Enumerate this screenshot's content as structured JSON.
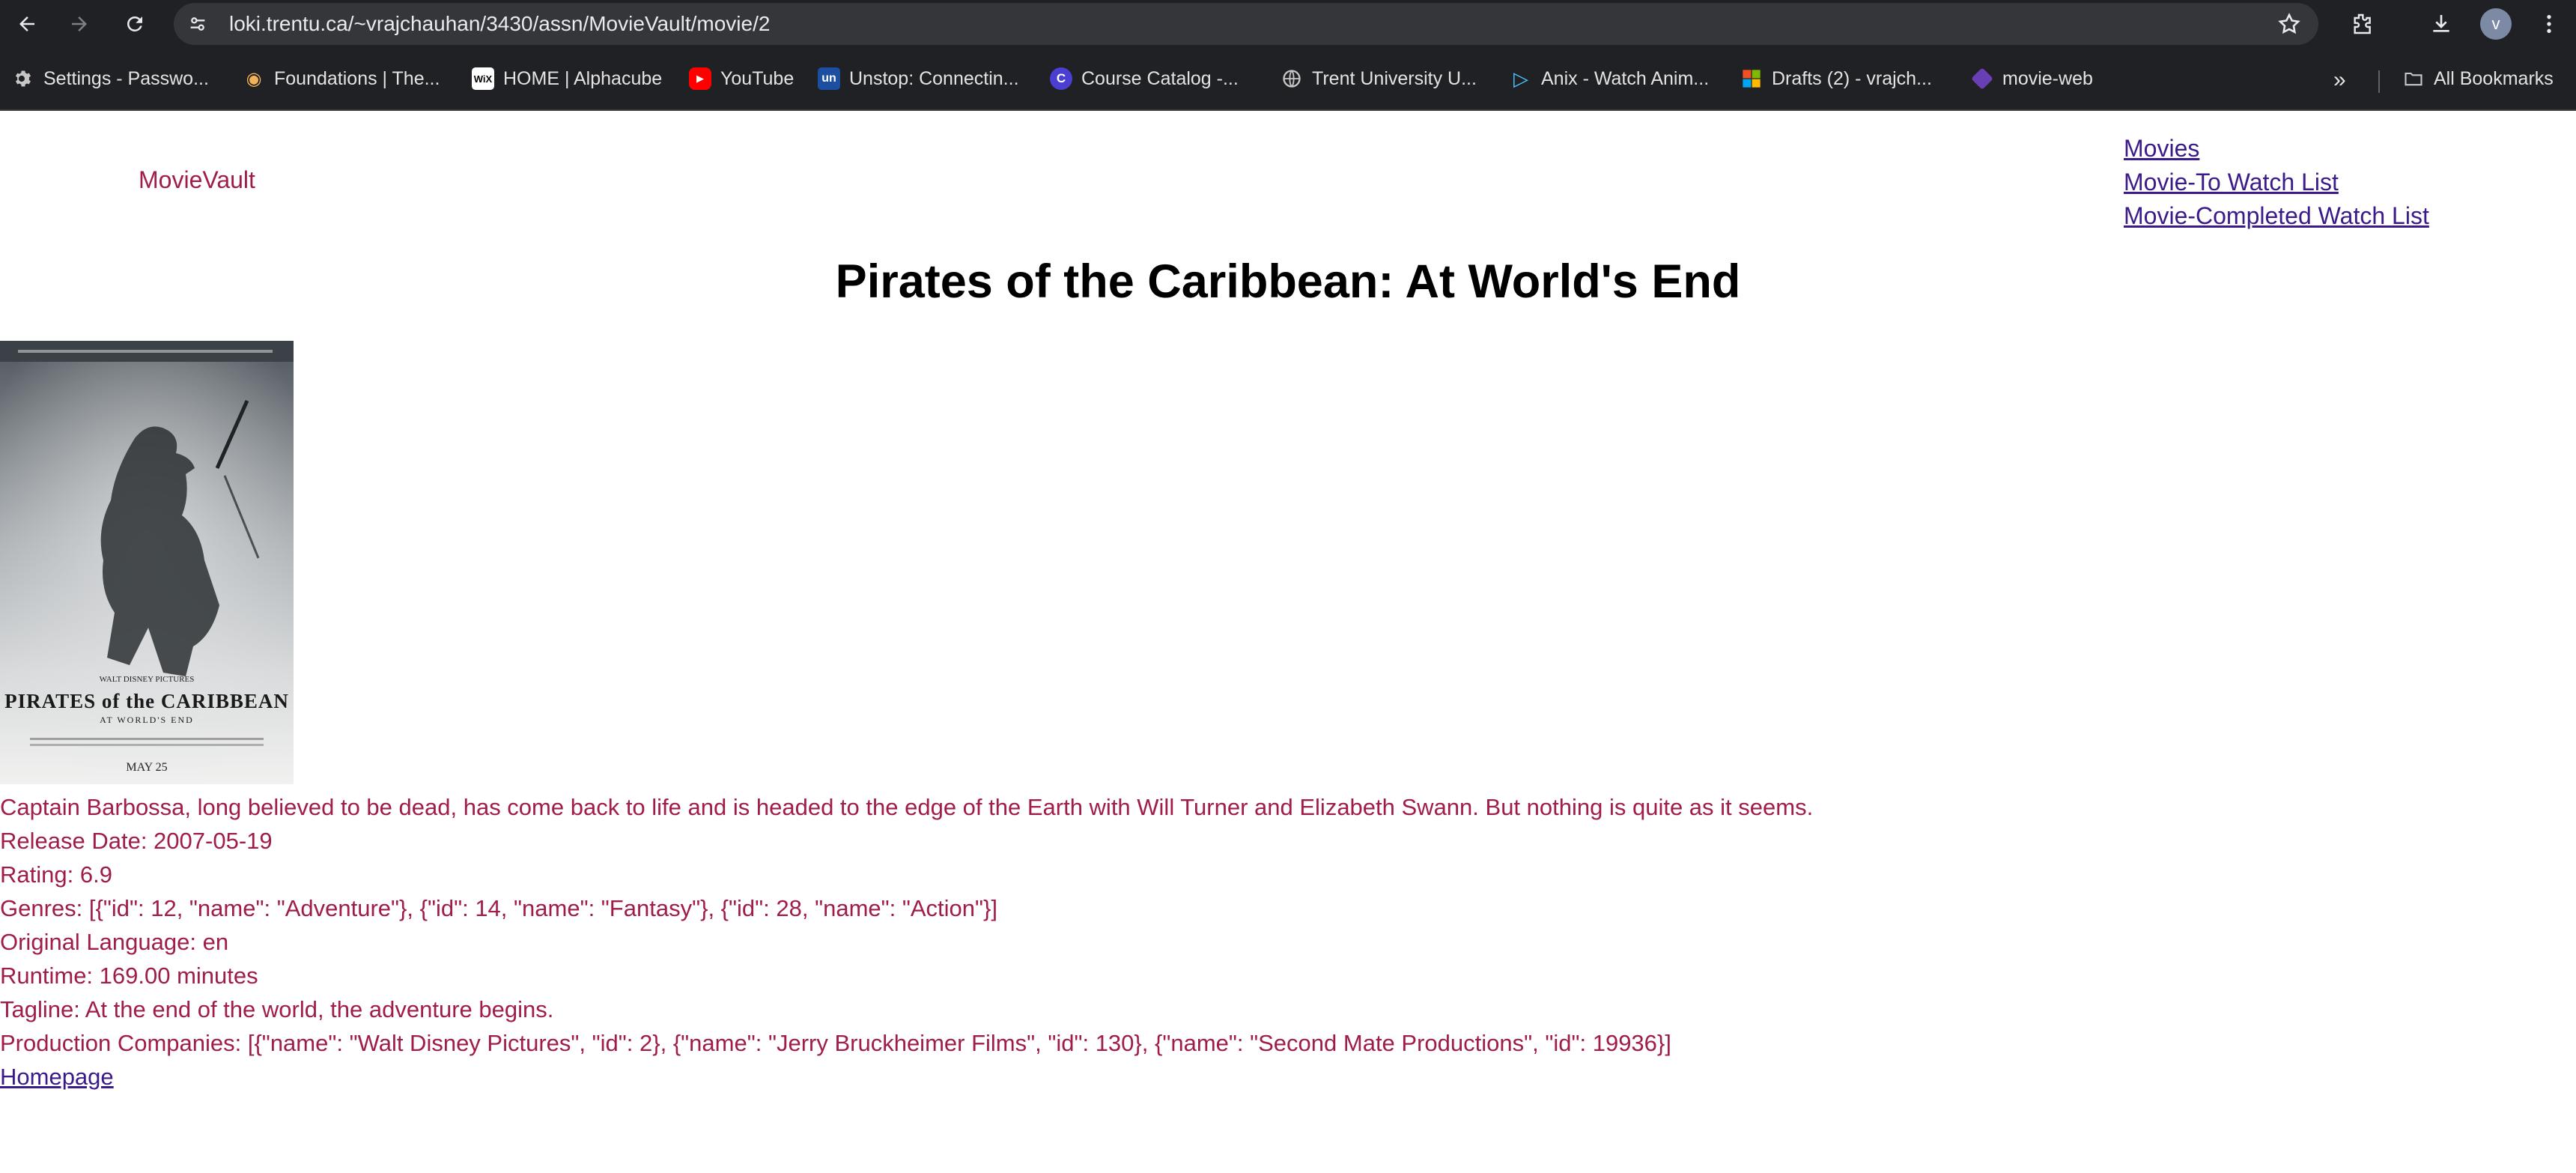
{
  "browser": {
    "url": "loki.trentu.ca/~vrajchauhan/3430/assn/MovieVault/movie/2",
    "avatar_letter": "v",
    "bookmarks": [
      {
        "label": "Settings - Passwo...",
        "icon": "gear-icon"
      },
      {
        "label": "Foundations | The...",
        "icon": "owl-icon"
      },
      {
        "label": "HOME | Alphacube",
        "icon": "wix-icon"
      },
      {
        "label": "YouTube",
        "icon": "youtube-icon"
      },
      {
        "label": "Unstop: Connectin...",
        "icon": "unstop-icon"
      },
      {
        "label": "Course Catalog -...",
        "icon": "catalog-icon"
      },
      {
        "label": "Trent University U...",
        "icon": "globe-icon"
      },
      {
        "label": "Anix - Watch Anim...",
        "icon": "play-icon"
      },
      {
        "label": "Drafts (2) - vrajch...",
        "icon": "microsoft-icon"
      },
      {
        "label": "movie-web",
        "icon": "movie-web-icon"
      }
    ],
    "all_bookmarks_label": "All Bookmarks"
  },
  "header": {
    "brand": "MovieVault",
    "nav": [
      "Movies",
      "Movie-To Watch List",
      "Movie-Completed Watch List"
    ]
  },
  "movie": {
    "title": "Pirates of the Caribbean: At World's End",
    "poster": {
      "brand_line": "WALT DISNEY PICTURES",
      "title_text": "PIRATES of the CARIBBEAN",
      "subtitle_text": "AT WORLD'S END",
      "date_text": "MAY 25"
    },
    "overview": "Captain Barbossa, long believed to be dead, has come back to life and is headed to the edge of the Earth with Will Turner and Elizabeth Swann. But nothing is quite as it seems.",
    "release_date": "Release Date: 2007-05-19",
    "rating": "Rating: 6.9",
    "genres": "Genres: [{\"id\": 12, \"name\": \"Adventure\"}, {\"id\": 14, \"name\": \"Fantasy\"}, {\"id\": 28, \"name\": \"Action\"}]",
    "original_language": "Original Language: en",
    "runtime": "Runtime: 169.00 minutes",
    "tagline": "Tagline: At the end of the world, the adventure begins.",
    "production_companies": "Production Companies: [{\"name\": \"Walt Disney Pictures\", \"id\": 2}, {\"name\": \"Jerry Bruckheimer Films\", \"id\": 130}, {\"name\": \"Second Mate Productions\", \"id\": 19936}]",
    "homepage_label": "Homepage"
  }
}
